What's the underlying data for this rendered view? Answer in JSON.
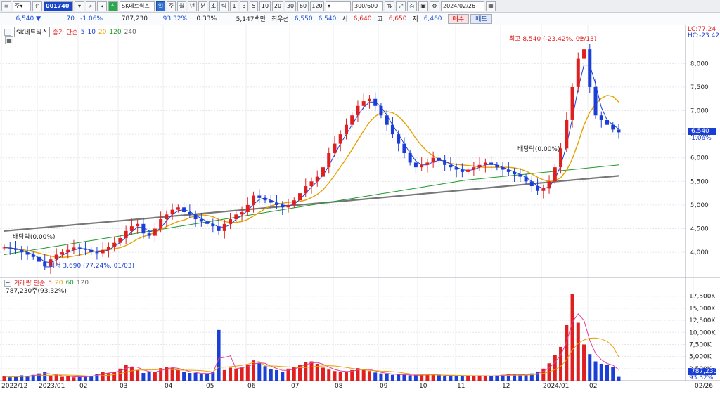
{
  "toolbar": {
    "code": "001740",
    "name": "SK네트웍스",
    "period": "주",
    "period_active": "일",
    "periods": [
      "일",
      "주",
      "월",
      "년",
      "분",
      "초",
      "틱"
    ],
    "nums": [
      "1",
      "3",
      "5",
      "10",
      "20",
      "30",
      "60",
      "120"
    ],
    "count": "300",
    "total": "/600",
    "date": "2024/02/26",
    "buy": "매수",
    "sell": "매도"
  },
  "quote": {
    "price": "6,540",
    "change": "70",
    "pct": "-1.06%",
    "volume": "787,230",
    "vol_ratio": "93.32%",
    "turnover": "0.33%",
    "amount": "5,147백만",
    "pref_label": "최우선",
    "ask": "6,550",
    "bid": "6,540",
    "open_l": "시",
    "open": "6,640",
    "high_l": "고",
    "high": "6,650",
    "low_l": "저",
    "low": "6,460"
  },
  "price_panel": {
    "title": "SK네트웍스",
    "legend_label": "종가 단순",
    "ma": [
      "5",
      "10",
      "20",
      "120",
      "240"
    ],
    "ma_colors": [
      "#1b3fd6",
      "#1b3fd6",
      "#e8a000",
      "#1f9a2b",
      "#666666"
    ],
    "lc": "LC:77.24",
    "hc": "HC:-23.42",
    "cur": "6,540",
    "cur_pct": "-1.06%",
    "high_note": "최고 8,540 (-23.42%, 02/13)",
    "low_note": "최저 3,690 (77.24%, 01/03)",
    "div1": "배당락(0.00%)",
    "div2": "배당락(0.00%)",
    "yticks": [
      "8,000",
      "7,500",
      "7,000",
      "6,500",
      "6,000",
      "5,500",
      "5,000",
      "4,500",
      "4,000"
    ]
  },
  "volume_panel": {
    "legend_label": "거래량 단순",
    "ma": [
      "5",
      "20",
      "60",
      "120"
    ],
    "ma_colors": [
      "#e02020",
      "#e8a000",
      "#1f9a2b",
      "#666666"
    ],
    "sub": "787,230주(93.32%)",
    "cur": "787,230",
    "cur_pct": "93.32%",
    "yticks": [
      "17,500K",
      "15,000K",
      "12,500K",
      "10,000K",
      "7,500K",
      "5,000K",
      "2,500K"
    ]
  },
  "xaxis": [
    "2022/12",
    "2023/01",
    "02",
    "03",
    "04",
    "05",
    "06",
    "07",
    "08",
    "09",
    "10",
    "11",
    "12",
    "2024/01",
    "02",
    "02/26"
  ],
  "chart_data": {
    "type": "candlestick",
    "months": [
      "2022/12",
      "2023/01",
      "02",
      "03",
      "04",
      "05",
      "06",
      "07",
      "08",
      "09",
      "10",
      "11",
      "12",
      "2024/01",
      "02"
    ],
    "close": [
      4100,
      4080,
      4050,
      4000,
      3950,
      3900,
      3800,
      3700,
      3850,
      3950,
      4000,
      4050,
      4100,
      4080,
      4050,
      4000,
      3980,
      4050,
      4120,
      4200,
      4300,
      4450,
      4550,
      4600,
      4400,
      4350,
      4500,
      4700,
      4800,
      4900,
      4950,
      4850,
      4800,
      4700,
      4650,
      4600,
      4550,
      4450,
      4600,
      4700,
      4800,
      4850,
      5000,
      5200,
      5150,
      5100,
      5050,
      5000,
      4950,
      5000,
      5100,
      5250,
      5400,
      5500,
      5600,
      5800,
      6100,
      6300,
      6500,
      6700,
      6900,
      7100,
      7200,
      7250,
      7100,
      6900,
      6700,
      6500,
      6300,
      6100,
      5900,
      5800,
      5850,
      5900,
      6000,
      5950,
      5850,
      5800,
      5750,
      5700,
      5750,
      5800,
      5850,
      5900,
      5850,
      5800,
      5750,
      5700,
      5650,
      5600,
      5500,
      5400,
      5300,
      5350,
      5500,
      5800,
      6200,
      6800,
      7500,
      8100,
      8300,
      7500,
      6900,
      6800,
      6700,
      6600,
      6540
    ],
    "volume_k": [
      900,
      700,
      800,
      1100,
      900,
      1200,
      1500,
      1800,
      900,
      1200,
      800,
      900,
      700,
      800,
      900,
      1000,
      1400,
      1800,
      1600,
      1900,
      2500,
      3300,
      2900,
      2200,
      1600,
      1900,
      1800,
      2600,
      2900,
      2600,
      2200,
      1900,
      1600,
      1600,
      1400,
      1500,
      1800,
      10500,
      2200,
      2700,
      2500,
      2900,
      3300,
      4200,
      3600,
      3000,
      2400,
      2200,
      1800,
      2500,
      2900,
      3200,
      3800,
      4000,
      3500,
      2700,
      2300,
      2000,
      1800,
      1900,
      2200,
      2600,
      2400,
      2000,
      1700,
      1500,
      1400,
      1200,
      1300,
      1200,
      1100,
      1100,
      1200,
      1300,
      1200,
      1100,
      1000,
      1000,
      900,
      900,
      1000,
      1100,
      1000,
      900,
      1000,
      1100,
      1200,
      1400,
      1300,
      1200,
      1100,
      1500,
      1900,
      2500,
      3600,
      5300,
      7000,
      11500,
      18000,
      12000,
      7500,
      5500,
      4000,
      3500,
      3200,
      2900,
      787
    ]
  }
}
